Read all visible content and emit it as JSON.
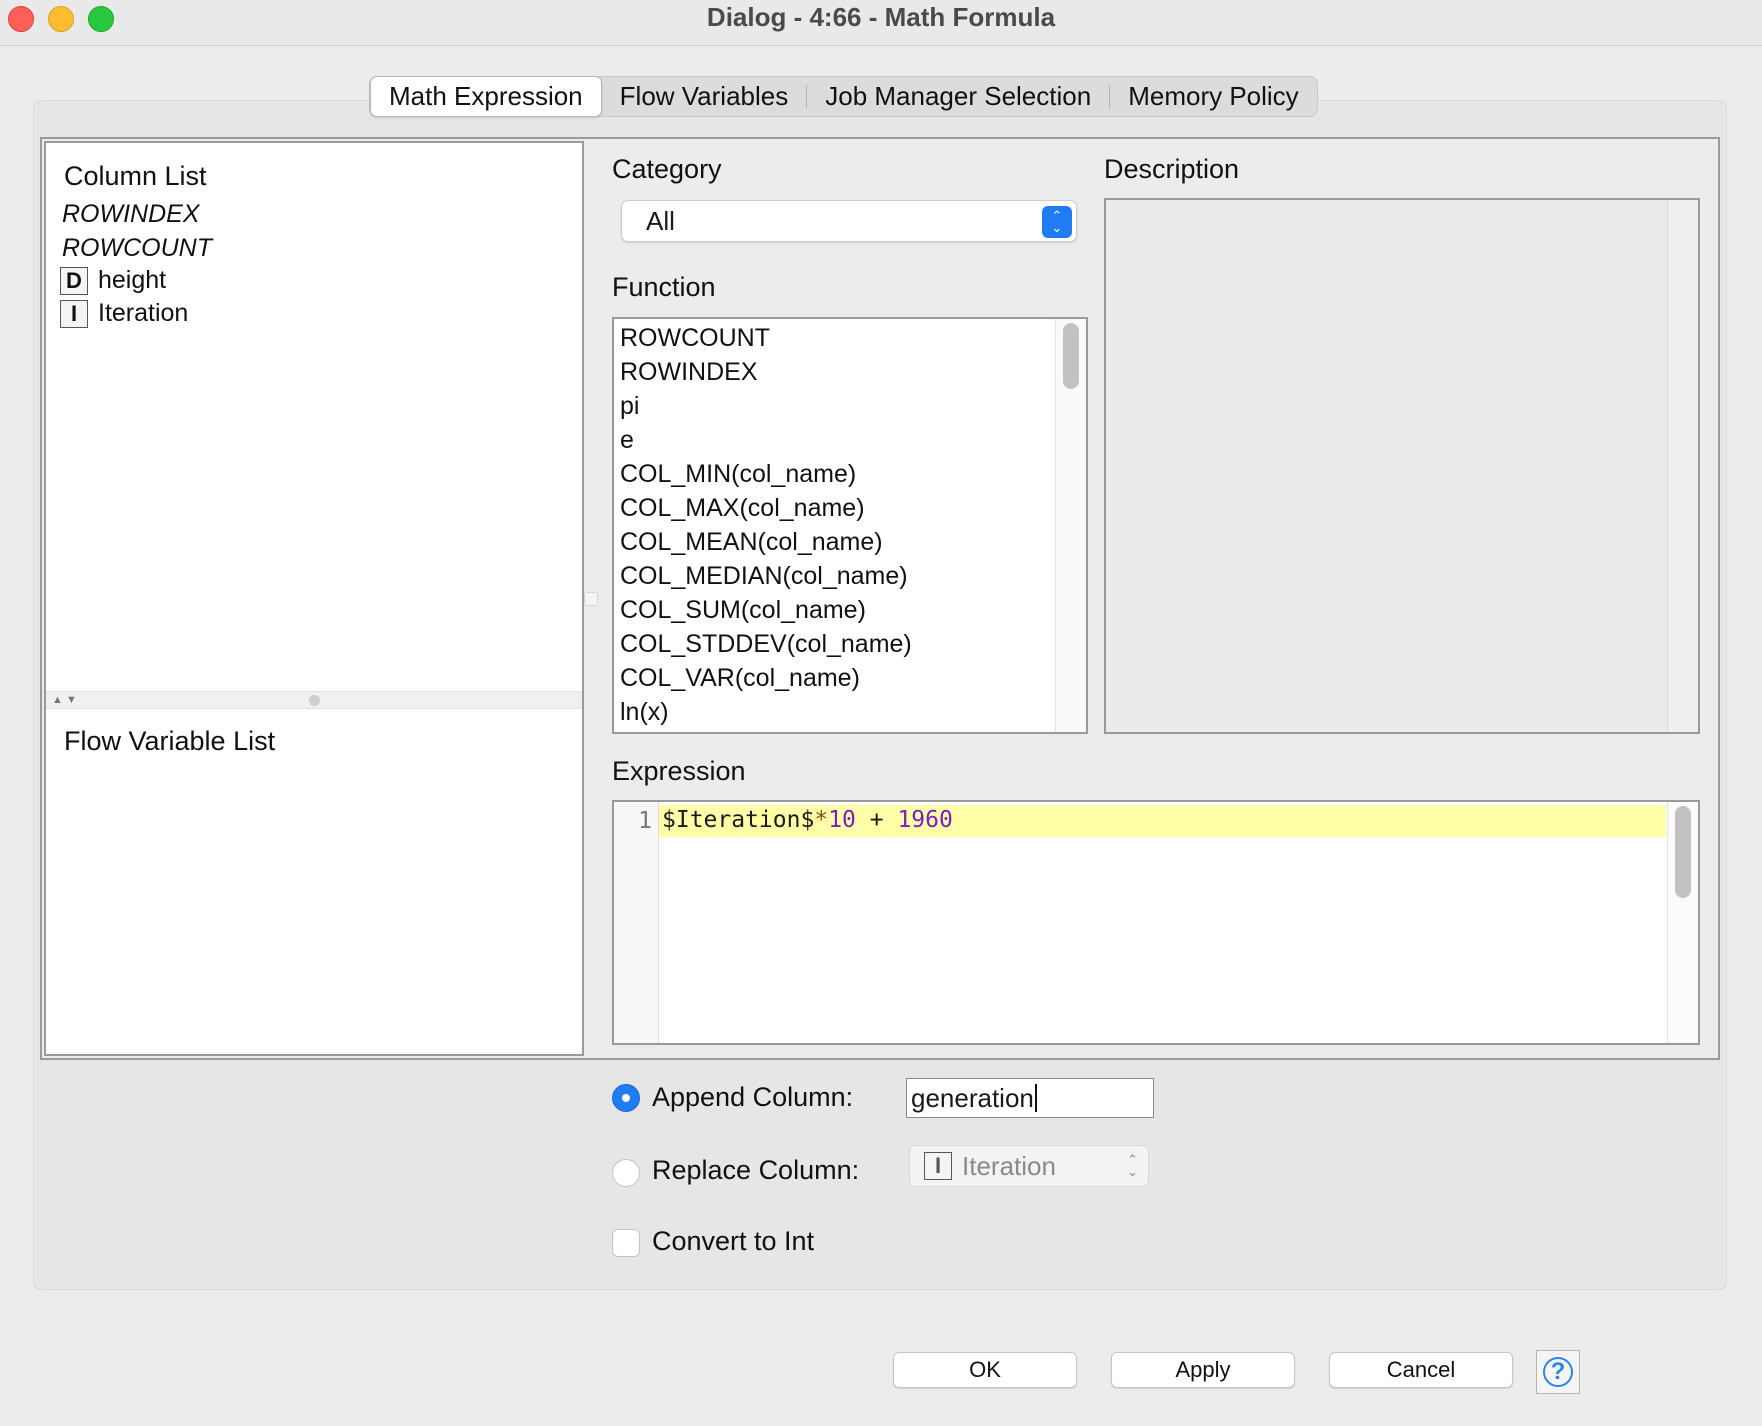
{
  "window": {
    "title": "Dialog - 4:66 - Math Formula"
  },
  "tabs": [
    {
      "label": "Math Expression",
      "active": true
    },
    {
      "label": "Flow Variables",
      "active": false
    },
    {
      "label": "Job Manager Selection",
      "active": false
    },
    {
      "label": "Memory Policy",
      "active": false
    }
  ],
  "column_list": {
    "heading": "Column List",
    "special_items": [
      "ROWINDEX",
      "ROWCOUNT"
    ],
    "columns": [
      {
        "type": "D",
        "name": "height"
      },
      {
        "type": "I",
        "name": "Iteration"
      }
    ]
  },
  "flow_variable_list": {
    "heading": "Flow Variable List"
  },
  "category": {
    "label": "Category",
    "selected": "All"
  },
  "function": {
    "label": "Function",
    "items": [
      "ROWCOUNT",
      "ROWINDEX",
      "pi",
      "e",
      "COL_MIN(col_name)",
      "COL_MAX(col_name)",
      "COL_MEAN(col_name)",
      "COL_MEDIAN(col_name)",
      "COL_SUM(col_name)",
      "COL_STDDEV(col_name)",
      "COL_VAR(col_name)",
      "ln(x)"
    ]
  },
  "description": {
    "label": "Description"
  },
  "expression": {
    "label": "Expression",
    "line_number": "1",
    "tokens": {
      "variable": "$Iteration$",
      "operator": "*",
      "number1": "10",
      "plus": " + ",
      "number2": "1960"
    }
  },
  "options": {
    "append_label": "Append Column:",
    "append_value": "generation",
    "append_selected": true,
    "replace_label": "Replace Column:",
    "replace_type": "I",
    "replace_value": "Iteration",
    "convert_label": "Convert to Int",
    "convert_checked": false
  },
  "buttons": {
    "ok": "OK",
    "apply": "Apply",
    "cancel": "Cancel",
    "help": "?"
  },
  "colors": {
    "accent": "#1f7cf4",
    "highlight_line": "#ffffa8",
    "number_token": "#7a1fc5"
  }
}
